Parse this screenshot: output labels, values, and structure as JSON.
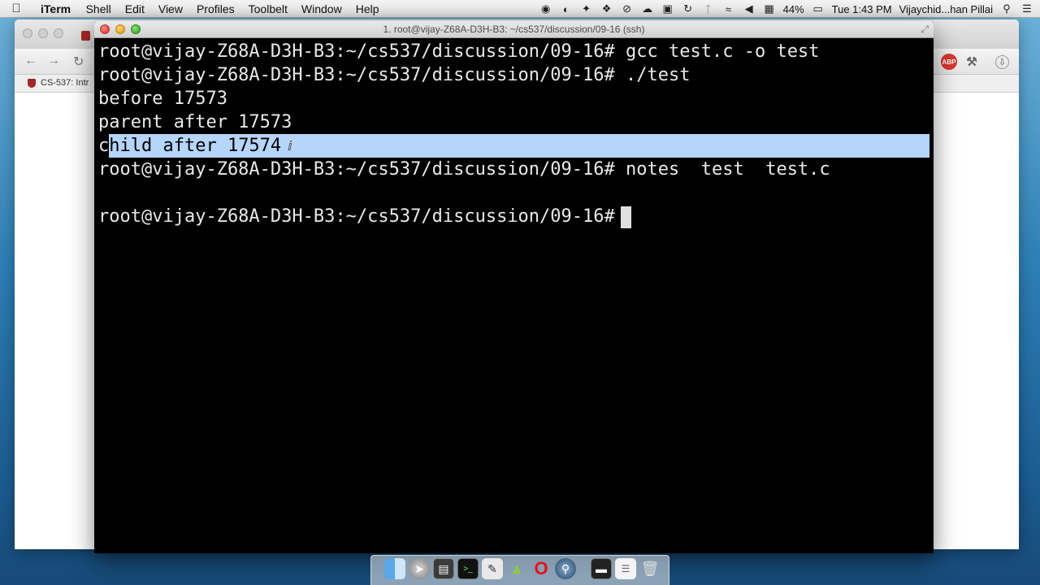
{
  "menubar": {
    "app_name": "iTerm",
    "menus": [
      "Shell",
      "Edit",
      "View",
      "Profiles",
      "Toolbelt",
      "Window",
      "Help"
    ],
    "battery": "44%",
    "clock": "Tue 1:43 PM",
    "user": "Vijaychid...han Pillai"
  },
  "browser": {
    "bookmark_label": "CS-537: Intr",
    "abp_label": "ABP"
  },
  "iterm": {
    "title": "1. root@vijay-Z68A-D3H-B3: ~/cs537/discussion/09-16 (ssh)"
  },
  "terminal": {
    "lines": [
      "root@vijay-Z68A-D3H-B3:~/cs537/discussion/09-16# gcc test.c -o test",
      "root@vijay-Z68A-D3H-B3:~/cs537/discussion/09-16# ./test",
      "before 17573",
      "parent after 17573",
      "child after 17574",
      "root@vijay-Z68A-D3H-B3:~/cs537/discussion/09-16# notes  test  test.c",
      "",
      "root@vijay-Z68A-D3H-B3:~/cs537/discussion/09-16# "
    ],
    "selected_line_prefix": "c",
    "selected_line_rest": "hild after 17574 "
  }
}
